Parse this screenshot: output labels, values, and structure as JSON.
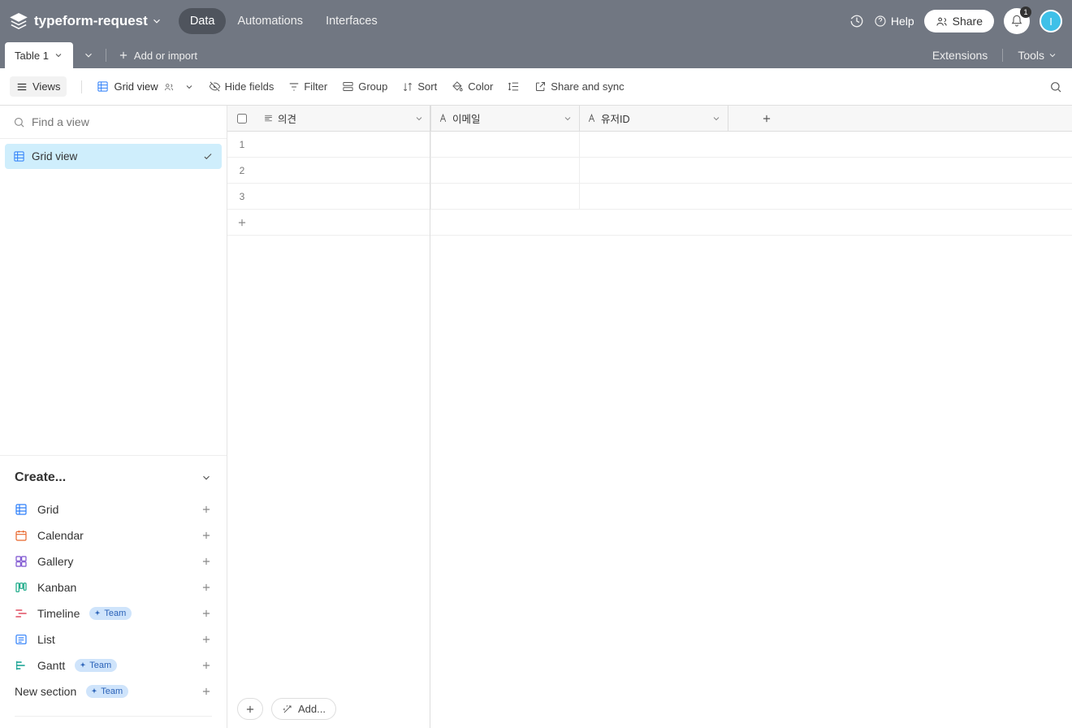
{
  "header": {
    "project_title": "typeform-request",
    "nav": [
      "Data",
      "Automations",
      "Interfaces"
    ],
    "help": "Help",
    "share": "Share",
    "notif_count": "1",
    "avatar_initial": "I"
  },
  "subheader": {
    "table_tab": "Table 1",
    "add_import": "Add or import",
    "extensions": "Extensions",
    "tools": "Tools"
  },
  "toolbar": {
    "views": "Views",
    "grid_view": "Grid view",
    "hide_fields": "Hide fields",
    "filter": "Filter",
    "group": "Group",
    "sort": "Sort",
    "color": "Color",
    "share_sync": "Share and sync"
  },
  "sidebar": {
    "find_placeholder": "Find a view",
    "active_view": "Grid view",
    "create_label": "Create...",
    "view_types": {
      "grid": "Grid",
      "calendar": "Calendar",
      "gallery": "Gallery",
      "kanban": "Kanban",
      "timeline": "Timeline",
      "list": "List",
      "gantt": "Gantt",
      "new_section": "New section"
    },
    "team_badge": "Team"
  },
  "grid": {
    "columns": [
      "의견",
      "이메일",
      "유저ID"
    ],
    "rows": [
      "1",
      "2",
      "3"
    ],
    "add_label": "Add..."
  }
}
